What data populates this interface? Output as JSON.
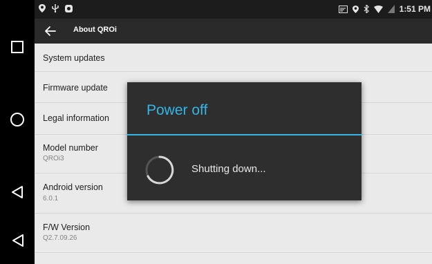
{
  "status_bar": {
    "left_icons": [
      "location-icon",
      "usb-icon",
      "app-notification-icon"
    ],
    "right_icons": [
      "cast-icon",
      "location-icon",
      "bluetooth-icon",
      "wifi-icon",
      "battery-icon"
    ],
    "time": "1:51 PM"
  },
  "action_bar": {
    "title": "About QROi"
  },
  "settings": [
    {
      "title": "System updates",
      "subtitle": ""
    },
    {
      "title": "Firmware update",
      "subtitle": ""
    },
    {
      "title": "Legal information",
      "subtitle": ""
    },
    {
      "title": "Model number",
      "subtitle": "QROi3"
    },
    {
      "title": "Android version",
      "subtitle": "6.0.1"
    },
    {
      "title": "F/W Version",
      "subtitle": "Q2.7.09.26"
    }
  ],
  "dialog": {
    "title": "Power off",
    "message": "Shutting down...",
    "accent_color": "#33b5e5"
  },
  "nav_bar": {
    "buttons": [
      "recents-button",
      "home-button",
      "back-button",
      "back-alt-button"
    ]
  }
}
